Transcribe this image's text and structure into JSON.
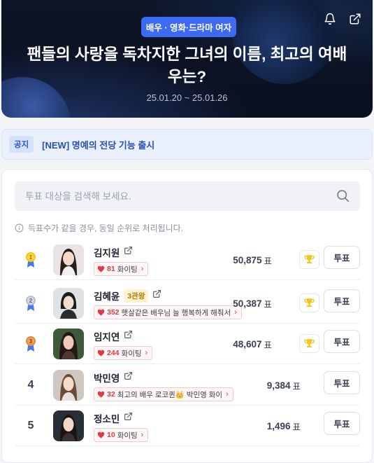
{
  "header": {
    "category": "배우 · 영화·드라마 여자",
    "title": "팬들의 사랑을 독차지한 그녀의 이름, 최고의 여배우는?",
    "date_range": "25.01.20 ~ 25.01.26",
    "icons": [
      "bell-icon",
      "share-icon"
    ]
  },
  "notice": {
    "tag": "공지",
    "text": "[NEW] 명예의 전당 기능 출시"
  },
  "search": {
    "placeholder": "투표 대상을 검색해 보세요."
  },
  "info_text": "득표수가 같을 경우, 동일 순위로 처리됩니다.",
  "vote_label": "투표",
  "vote_unit": "표",
  "colors": {
    "accent": "#3d6af2",
    "cheer": "#e23a44",
    "gold": "#f5c518",
    "silver": "#b8c0cc",
    "bronze": "#e08a3c"
  },
  "rows": [
    {
      "rank": "1",
      "medal": "gold",
      "name": "김지원",
      "badge": "",
      "cheer_count": "81",
      "cheer_text": "화이팅",
      "votes": "50,875"
    },
    {
      "rank": "2",
      "medal": "silver",
      "name": "김혜윤",
      "badge": "3관왕",
      "cheer_count": "352",
      "cheer_text": "햇살같은 배우님 늘 행복하게 해줘서",
      "votes": "50,387"
    },
    {
      "rank": "3",
      "medal": "bronze",
      "name": "임지연",
      "badge": "",
      "cheer_count": "244",
      "cheer_text": "화이팅",
      "votes": "48,607"
    },
    {
      "rank": "4",
      "medal": "",
      "name": "박민영",
      "badge": "",
      "cheer_count": "32",
      "cheer_text": "최고의 배우 로코퀸👑 박민영 화이",
      "votes": "9,384"
    },
    {
      "rank": "5",
      "medal": "",
      "name": "정소민",
      "badge": "",
      "cheer_count": "10",
      "cheer_text": "화이팅",
      "votes": "1,496"
    }
  ]
}
